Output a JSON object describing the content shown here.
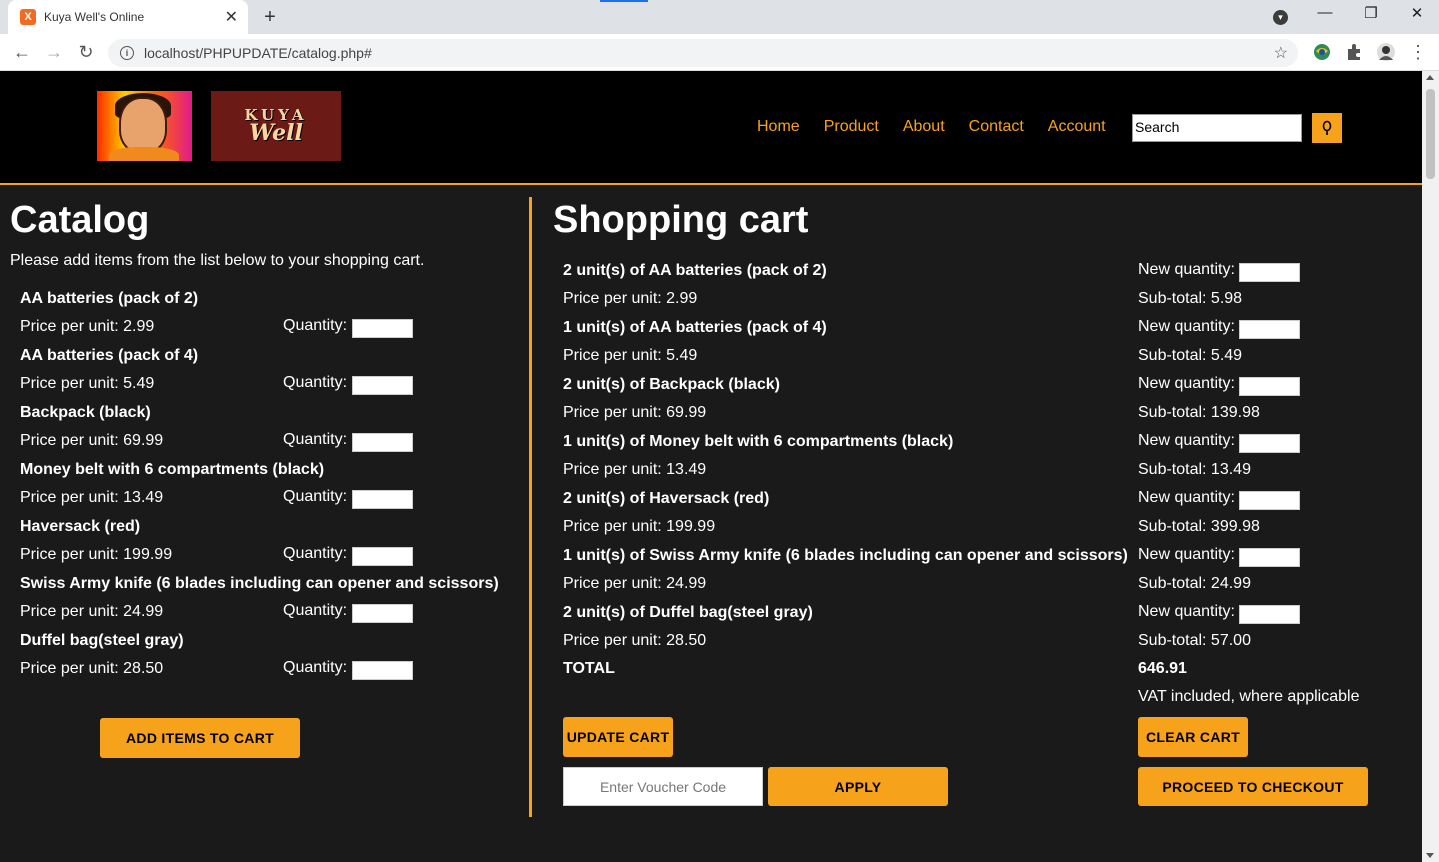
{
  "browser": {
    "tab_title": "Kuya Well's Online",
    "favicon_letter": "X",
    "tab_close": "✕",
    "new_tab": "+",
    "url": "localhost/PHPUPDATE/catalog.php#",
    "min": "—",
    "max": "❐",
    "close": "✕",
    "back": "←",
    "forward": "→",
    "reload": "↻",
    "star": "☆",
    "menu": "⋮",
    "info": "i"
  },
  "header": {
    "logo_top": "KUYA",
    "logo_bottom": "Well",
    "nav": [
      "Home",
      "Product",
      "About",
      "Contact",
      "Account"
    ],
    "search_value": "Search"
  },
  "catalog": {
    "title": "Catalog",
    "subtext": "Please add items from the list below to your shopping cart.",
    "qty_label": "Quantity:",
    "items": [
      {
        "name": "AA batteries (pack of 2)",
        "price": "Price per unit: 2.99"
      },
      {
        "name": "AA batteries (pack of 4)",
        "price": "Price per unit: 5.49"
      },
      {
        "name": "Backpack (black)",
        "price": "Price per unit: 69.99"
      },
      {
        "name": "Money belt with 6 compartments (black)",
        "price": "Price per unit: 13.49"
      },
      {
        "name": "Haversack (red)",
        "price": "Price per unit: 199.99"
      },
      {
        "name": "Swiss Army knife (6 blades including can opener and scissors)",
        "price": "Price per unit: 24.99"
      },
      {
        "name": "Duffel bag(steel gray)",
        "price": "Price per unit: 28.50"
      }
    ],
    "add_button": "ADD ITEMS TO CART"
  },
  "cart": {
    "title": "Shopping cart",
    "new_qty_label": "New quantity:",
    "items": [
      {
        "line": "2 unit(s) of AA batteries (pack of 2)",
        "price": "Price per unit: 2.99",
        "subtotal": "Sub-total: 5.98"
      },
      {
        "line": "1 unit(s) of AA batteries (pack of 4)",
        "price": "Price per unit: 5.49",
        "subtotal": "Sub-total: 5.49"
      },
      {
        "line": "2 unit(s) of Backpack (black)",
        "price": "Price per unit: 69.99",
        "subtotal": "Sub-total: 139.98"
      },
      {
        "line": "1 unit(s) of Money belt with 6 compartments (black)",
        "price": "Price per unit: 13.49",
        "subtotal": "Sub-total: 13.49"
      },
      {
        "line": "2 unit(s) of Haversack (red)",
        "price": "Price per unit: 199.99",
        "subtotal": "Sub-total: 399.98"
      },
      {
        "line": "1 unit(s) of Swiss Army knife (6 blades including can opener and scissors)",
        "price": "Price per unit: 24.99",
        "subtotal": "Sub-total: 24.99"
      },
      {
        "line": "2 unit(s) of Duffel bag(steel gray)",
        "price": "Price per unit: 28.50",
        "subtotal": "Sub-total: 57.00"
      }
    ],
    "total_label": "TOTAL",
    "total_value": "646.91",
    "vat_note": "VAT included, where applicable",
    "update_button": "UPDATE CART",
    "clear_button": "CLEAR CART",
    "voucher_placeholder": "Enter Voucher Code",
    "apply_button": "APPLY",
    "checkout_button": "PROCEED TO CHECKOUT"
  },
  "colors": {
    "accent": "#f7a21b",
    "background": "#1a1a1a",
    "header": "#000000"
  }
}
